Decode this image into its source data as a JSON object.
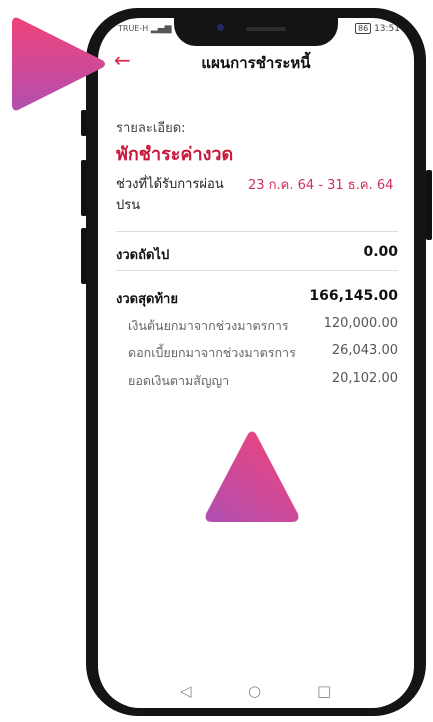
{
  "status_bar": {
    "carrier": "TRUE-H",
    "battery": "86",
    "time": "13:51"
  },
  "header": {
    "back_icon": "arrow-left-icon",
    "title": "แผนการชำระหนี้"
  },
  "details": {
    "label": "รายละเอียด:",
    "status_title": "พักชำระค่างวด",
    "period_label": "ช่วงที่ได้รับการผ่อนปรน",
    "period_value": "23 ก.ค. 64 - 31 ธ.ค. 64"
  },
  "next_installment": {
    "label": "งวดถัดไป",
    "value": "0.00"
  },
  "last_installment": {
    "label": "งวดสุดท้าย",
    "value": "166,145.00",
    "breakdown": [
      {
        "label": "เงินต้นยกมาจากช่วงมาตรการ",
        "value": "120,000.00"
      },
      {
        "label": "ดอกเบี้ยยกมาจากช่วงมาตรการ",
        "value": "26,043.00"
      },
      {
        "label": "ยอดเงินตามสัญญา",
        "value": "20,102.00"
      }
    ]
  },
  "navbar": {
    "back": "◁",
    "home": "○",
    "recent": "□"
  },
  "colors": {
    "accent": "#c8183c",
    "pointer_start": "#f0437a",
    "pointer_end": "#b24fb0"
  }
}
